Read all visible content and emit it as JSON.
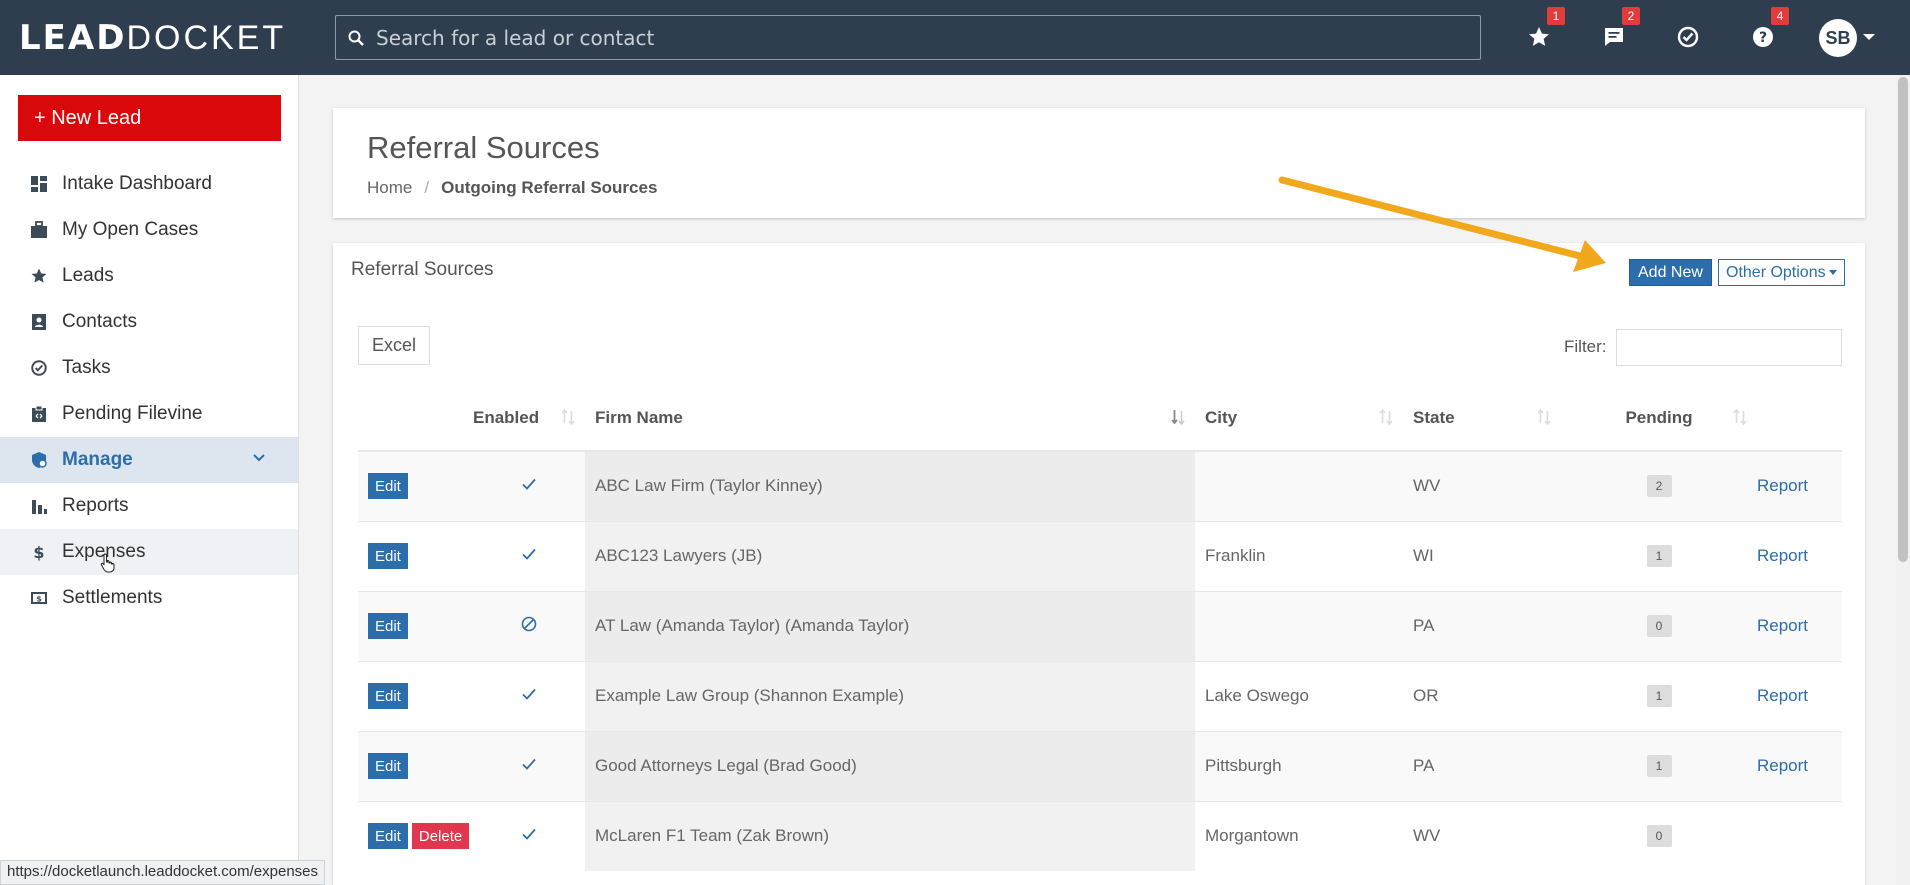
{
  "logo": {
    "lead": "LEAD",
    "docket": "DOCKET"
  },
  "search": {
    "placeholder": "Search for a lead or contact"
  },
  "topbar": {
    "icons": [
      {
        "name": "star-icon",
        "badge": "1"
      },
      {
        "name": "chat-icon",
        "badge": "2"
      },
      {
        "name": "check-circle-icon",
        "badge": ""
      },
      {
        "name": "help-icon",
        "badge": "4"
      }
    ],
    "avatar": "SB"
  },
  "sidebar": {
    "new_lead": "+  New Lead",
    "items": [
      {
        "label": "Intake Dashboard",
        "icon": "dashboard-icon"
      },
      {
        "label": "My Open Cases",
        "icon": "briefcase-icon"
      },
      {
        "label": "Leads",
        "icon": "star-icon"
      },
      {
        "label": "Contacts",
        "icon": "contacts-icon"
      },
      {
        "label": "Tasks",
        "icon": "check-circle-icon"
      },
      {
        "label": "Pending Filevine",
        "icon": "clipboard-icon"
      },
      {
        "label": "Manage",
        "icon": "shield-gear-icon"
      },
      {
        "label": "Reports",
        "icon": "bar-chart-icon"
      },
      {
        "label": "Expenses",
        "icon": "dollar-icon"
      },
      {
        "label": "Settlements",
        "icon": "money-icon"
      }
    ]
  },
  "header": {
    "title": "Referral Sources",
    "breadcrumb_home": "Home",
    "breadcrumb_sep": "/",
    "breadcrumb_current": "Outgoing Referral Sources"
  },
  "panel": {
    "title": "Referral Sources",
    "add_new": "Add New",
    "other_options": "Other Options",
    "excel": "Excel",
    "filter_label": "Filter:",
    "filter_value": ""
  },
  "table": {
    "columns": [
      "Enabled",
      "Firm Name",
      "City",
      "State",
      "Pending"
    ],
    "rows": [
      {
        "edit": "Edit",
        "delete": "",
        "enabled": true,
        "firm": "ABC Law Firm (Taylor Kinney)",
        "city": "",
        "state": "WV",
        "pending": "2",
        "report": "Report"
      },
      {
        "edit": "Edit",
        "delete": "",
        "enabled": true,
        "firm": "ABC123 Lawyers (JB)",
        "city": "Franklin",
        "state": "WI",
        "pending": "1",
        "report": "Report"
      },
      {
        "edit": "Edit",
        "delete": "",
        "enabled": false,
        "firm": "AT Law (Amanda Taylor) (Amanda Taylor)",
        "city": "",
        "state": "PA",
        "pending": "0",
        "report": "Report"
      },
      {
        "edit": "Edit",
        "delete": "",
        "enabled": true,
        "firm": "Example Law Group (Shannon Example)",
        "city": "Lake Oswego",
        "state": "OR",
        "pending": "1",
        "report": "Report"
      },
      {
        "edit": "Edit",
        "delete": "",
        "enabled": true,
        "firm": "Good Attorneys Legal (Brad Good)",
        "city": "Pittsburgh",
        "state": "PA",
        "pending": "1",
        "report": "Report"
      },
      {
        "edit": "Edit",
        "delete": "Delete",
        "enabled": true,
        "firm": "McLaren F1 Team (Zak Brown)",
        "city": "Morgantown",
        "state": "WV",
        "pending": "0",
        "report": ""
      }
    ]
  },
  "status_url": "https://docketlaunch.leaddocket.com/expenses",
  "colors": {
    "topbar": "#2f3e4f",
    "accent": "#2c6dab",
    "new_lead": "#d9080b",
    "badge": "#e23b3b",
    "arrow": "#f2a81d"
  }
}
